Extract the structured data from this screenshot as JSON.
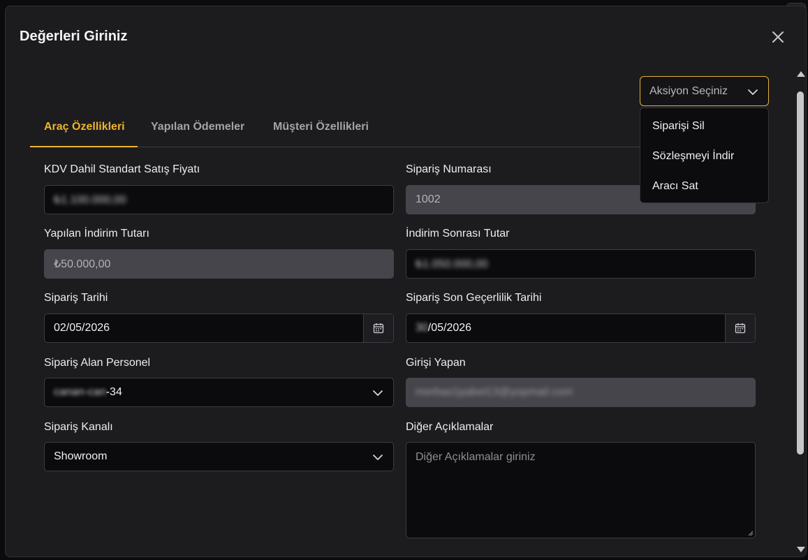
{
  "modal": {
    "title": "Değerleri Giriniz",
    "close_icon": "close-icon"
  },
  "actions": {
    "placeholder": "Aksiyon Seçiniz",
    "options": [
      "Siparişi Sil",
      "Sözleşmeyi İndir",
      "Aracı Sat"
    ]
  },
  "tabs": [
    {
      "label": "Araç Özellikleri",
      "active": true
    },
    {
      "label": "Yapılan Ödemeler",
      "active": false
    },
    {
      "label": "Müşteri Özellikleri",
      "active": false
    }
  ],
  "form": {
    "list_price": {
      "label": "KDV Dahil Standart Satış Fiyatı",
      "value": "₺1.100.000,00"
    },
    "order_number": {
      "label": "Sipariş Numarası",
      "value": "1002"
    },
    "discount_amount": {
      "label": "Yapılan İndirim Tutarı",
      "value": "₺50.000,00"
    },
    "post_discount": {
      "label": "İndirim Sonrası Tutar",
      "value": "₺1.050.000,00"
    },
    "order_date": {
      "label": "Sipariş Tarihi",
      "value": "02/05/2026"
    },
    "expiry_date": {
      "label": "Sipariş Son Geçerlilik Tarihi",
      "value_hidden": "30",
      "value_visible": "/05/2026"
    },
    "staff": {
      "label": "Sipariş Alan Personel",
      "value_hidden": "canan-can",
      "value_visible": "-34"
    },
    "entered_by": {
      "label": "Girişi Yapan",
      "value": "merbas1pabel13@yopmail.com"
    },
    "channel": {
      "label": "Sipariş Kanalı",
      "value": "Showroom"
    },
    "notes": {
      "label": "Diğer Açıklamalar",
      "placeholder": "Diğer Açıklamalar giriniz"
    }
  },
  "colors": {
    "accent": "#f0b429",
    "surface": "#1c1c1f",
    "input_bg": "#0b0b0d",
    "disabled_bg": "#45454b"
  }
}
